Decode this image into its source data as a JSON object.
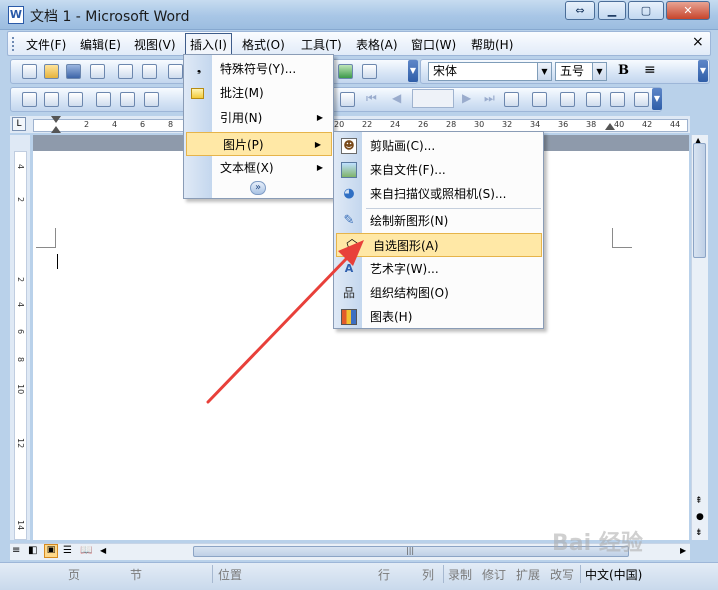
{
  "window": {
    "title": "文档 1 - Microsoft Word",
    "app_icon": "W"
  },
  "menubar": {
    "items": [
      {
        "label": "文件(F)",
        "name": "menu-file"
      },
      {
        "label": "编辑(E)",
        "name": "menu-edit"
      },
      {
        "label": "视图(V)",
        "name": "menu-view"
      },
      {
        "label": "插入(I)",
        "name": "menu-insert"
      },
      {
        "label": "格式(O)",
        "name": "menu-format"
      },
      {
        "label": "工具(T)",
        "name": "menu-tools"
      },
      {
        "label": "表格(A)",
        "name": "menu-table"
      },
      {
        "label": "窗口(W)",
        "name": "menu-window"
      },
      {
        "label": "帮助(H)",
        "name": "menu-help"
      }
    ],
    "close_glyph": "×"
  },
  "formatting": {
    "font": "宋体",
    "size": "五号",
    "bold_label": "B"
  },
  "ruler": {
    "ticks": [
      "2",
      "4",
      "6",
      "8",
      "20",
      "22",
      "24",
      "26",
      "28",
      "30",
      "32",
      "34",
      "36",
      "38",
      "40",
      "42",
      "44"
    ]
  },
  "vruler": {
    "ticks": [
      "4",
      "2",
      "2",
      "4",
      "6",
      "8",
      "10",
      "12",
      "14"
    ]
  },
  "insert_menu": {
    "items": [
      {
        "label": "特殊符号(Y)...",
        "icon": "special-symbol-icon",
        "submenu": false
      },
      {
        "label": "批注(M)",
        "icon": "comment-icon",
        "submenu": false
      },
      {
        "label": "引用(N)",
        "icon": "",
        "submenu": true
      },
      {
        "label": "图片(P)",
        "icon": "",
        "submenu": true,
        "highlighted": true
      },
      {
        "label": "文本框(X)",
        "icon": "",
        "submenu": true
      }
    ],
    "expand_glyph": "»"
  },
  "picture_submenu": {
    "items": [
      {
        "label": "剪贴画(C)...",
        "icon": "clip-art-icon"
      },
      {
        "label": "来自文件(F)...",
        "icon": "picture-from-file-icon"
      },
      {
        "label": "来自扫描仪或照相机(S)...",
        "icon": "scanner-camera-icon"
      },
      {
        "label": "绘制新图形(N)",
        "icon": "new-drawing-icon"
      },
      {
        "label": "自选图形(A)",
        "icon": "autoshapes-icon",
        "highlighted": true
      },
      {
        "label": "艺术字(W)...",
        "icon": "wordart-icon"
      },
      {
        "label": "组织结构图(O)",
        "icon": "org-chart-icon"
      },
      {
        "label": "图表(H)",
        "icon": "chart-icon"
      }
    ]
  },
  "statusbar": {
    "page": "页",
    "section": "节",
    "position": "位置",
    "line": "行",
    "column": "列",
    "rec": "录制",
    "trk": "修订",
    "ext": "扩展",
    "ovr": "改写",
    "language": "中文(中国)"
  },
  "watermark": "Bai 经验"
}
